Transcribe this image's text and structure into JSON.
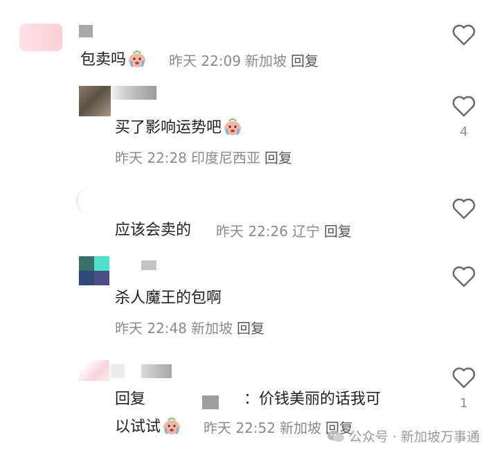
{
  "comments": [
    {
      "text": "包卖吗",
      "time": "昨天 22:09",
      "location": "新加坡",
      "reply_label": "回复",
      "likes": ""
    },
    {
      "text": "买了影响运势吧",
      "time": "昨天 22:28",
      "location": "印度尼西亚",
      "reply_label": "回复",
      "likes": "4"
    },
    {
      "text": "应该会卖的",
      "time": "昨天 22:26",
      "location": "辽宁",
      "reply_label": "回复",
      "likes": ""
    },
    {
      "text": "杀人魔王的包啊",
      "time": "昨天 22:48",
      "location": "新加坡",
      "reply_label": "回复",
      "likes": ""
    },
    {
      "reply_prefix": "回复",
      "colon": "：",
      "text_line1": "价钱美丽的话我可",
      "text_line2": "以试试",
      "time": "昨天 22:52",
      "location": "新加坡",
      "reply_label": "回复",
      "likes": "1"
    }
  ],
  "watermark": {
    "prefix": "公众号",
    "separator": "·",
    "name": "新加坡万事通"
  },
  "colors": {
    "heart_stroke": "#6b6b6b",
    "meta_text": "#8a8a8a",
    "body_text": "#1f1f1f"
  },
  "icons": [
    "heart-icon",
    "crying-emoji-icon",
    "wechat-icon"
  ]
}
